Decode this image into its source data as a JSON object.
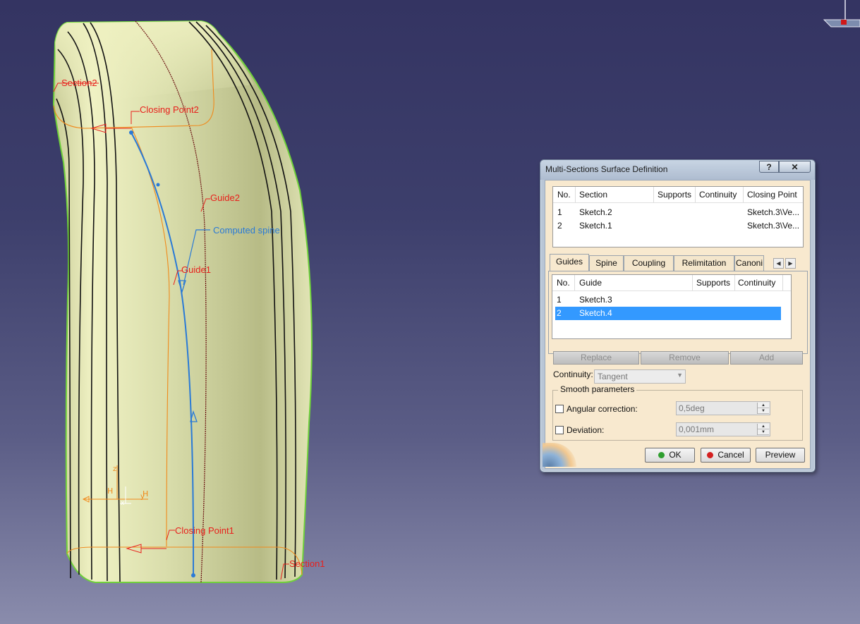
{
  "viewport": {
    "labels": {
      "section2": "Section2",
      "closing_point2": "Closing Point2",
      "guide2": "Guide2",
      "computed_spine": "Computed spine",
      "guide1": "Guide1",
      "closing_point1": "Closing Point1",
      "section1": "Section1"
    },
    "axis": {
      "z": "z",
      "y": "y",
      "x": "x",
      "h1": "H",
      "h2": "H"
    }
  },
  "dialog": {
    "title": "Multi-Sections Surface Definition",
    "help_label": "?",
    "close_label": "✕",
    "sections_table": {
      "headers": {
        "no": "No.",
        "section": "Section",
        "supports": "Supports",
        "continuity": "Continuity",
        "closing_point": "Closing Point"
      },
      "rows": [
        {
          "no": "1",
          "section": "Sketch.2",
          "supports": "",
          "continuity": "",
          "closing_point": "Sketch.3\\Ve..."
        },
        {
          "no": "2",
          "section": "Sketch.1",
          "supports": "",
          "continuity": "",
          "closing_point": "Sketch.3\\Ve..."
        }
      ]
    },
    "tabs": [
      "Guides",
      "Spine",
      "Coupling",
      "Relimitation",
      "Canoni"
    ],
    "active_tab": "Guides",
    "guides_table": {
      "headers": {
        "no": "No.",
        "guide": "Guide",
        "supports": "Supports",
        "continuity": "Continuity"
      },
      "rows": [
        {
          "no": "1",
          "guide": "Sketch.3",
          "supports": "",
          "continuity": ""
        },
        {
          "no": "2",
          "guide": "Sketch.4",
          "supports": "",
          "continuity": "",
          "selected": true
        }
      ]
    },
    "buttons": {
      "replace": "Replace",
      "remove": "Remove",
      "add": "Add"
    },
    "continuity_label": "Continuity:",
    "continuity_value": "Tangent",
    "smooth": {
      "title": "Smooth parameters",
      "angular_label": "Angular correction:",
      "angular_value": "0,5deg",
      "angular_checked": false,
      "deviation_label": "Deviation:",
      "deviation_value": "0,001mm",
      "deviation_checked": false
    },
    "footer": {
      "ok": "OK",
      "cancel": "Cancel",
      "preview": "Preview"
    },
    "colors": {
      "ok_dot": "#2e9e2e",
      "cancel_dot": "#d42020",
      "selection": "#3399ff"
    }
  }
}
